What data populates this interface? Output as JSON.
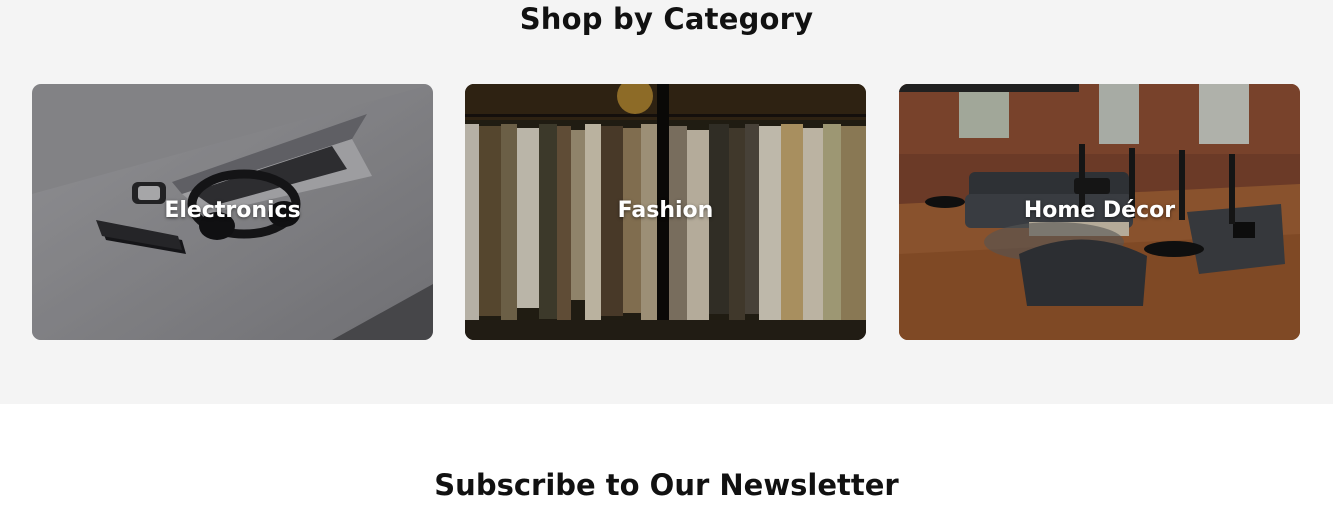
{
  "categories": {
    "title": "Shop by Category",
    "items": [
      {
        "label": "Electronics"
      },
      {
        "label": "Fashion"
      },
      {
        "label": "Home Décor"
      }
    ]
  },
  "newsletter": {
    "title": "Subscribe to Our Newsletter"
  }
}
